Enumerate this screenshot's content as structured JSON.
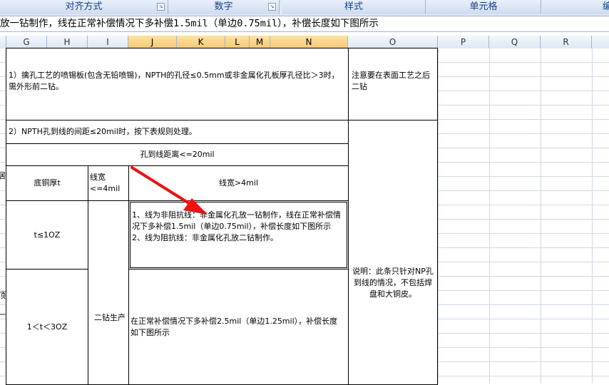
{
  "ribbon": {
    "groups": [
      "对齐方式",
      "数字",
      "样式",
      "单元格",
      "编"
    ]
  },
  "formula_bar": {
    "content": "放一钻制作，线在正常补偿情况下多补偿1.5mil（单边0.75mil），补偿长度如下图所示"
  },
  "columns": [
    "G",
    "H",
    "I",
    "J",
    "K",
    "L",
    "M",
    "N",
    "O",
    "P",
    "Q",
    "R"
  ],
  "cells": {
    "rule1": "1）擒孔工艺的喷锡板(包含无铅喷锡)，NPTH的孔径≤0.5mm或非金属化孔板厚孔径比＞3时，需外形前二钻。",
    "note1": "注意要在表面工艺之后二钻",
    "rule2": "2）NPTH孔到线的间距≤20mil时，按下表规则处理。",
    "header_main": "孔到线距离<=20mil",
    "copper_thickness": "底铜厚t",
    "line_width_small": "线宽<=4mil",
    "line_width_large": "线宽>4mil",
    "t_le_10": "t≤1OZ",
    "cond_line1": "1、线为非阻抗线：非金属化孔放一钻制作，线在正常补偿情况下多补偿1.5mil（单边0.75mil），补偿长度如下图所示",
    "cond_line2": "2、线为阻抗线：非金属化孔放二钻制作。",
    "t_range": "1＜t＜3OZ",
    "second_drill": "二钻生产",
    "compensation": "在正常补偿情况下多补偿2.5mil（单边1.25mil），补偿长度如下图所示",
    "explain": "说明：此条只针对NP孔到线的情况，不包括焊盘和大铜皮。",
    "left_frag1": "居",
    "left_frag2": "顶",
    "left_frag3": "一"
  },
  "colors": {
    "arrow": "#ee1111",
    "header_text": "#15428b",
    "selected_header": "#f7c770"
  }
}
